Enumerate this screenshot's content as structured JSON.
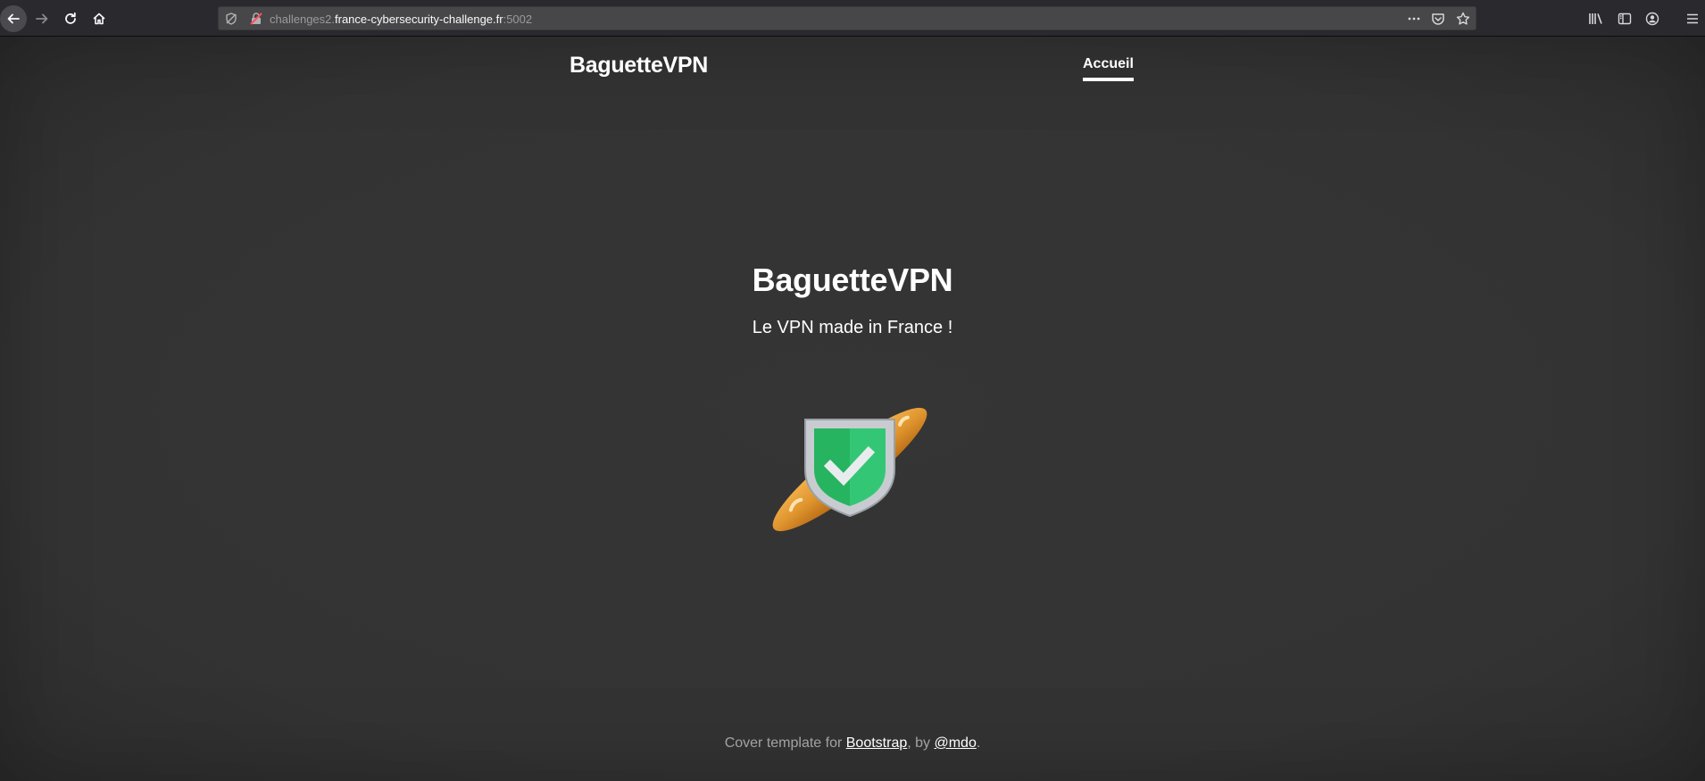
{
  "browser": {
    "url_prefix": "challenges2.",
    "url_host": "france-cybersecurity-challenge.fr",
    "url_suffix": ":5002",
    "icons": [
      "back-arrow-icon",
      "forward-arrow-icon",
      "reload-icon",
      "home-icon",
      "tracking-protection-icon",
      "insecure-lock-icon",
      "page-actions-icon",
      "pocket-icon",
      "bookmark-star-icon",
      "library-icon",
      "sidebar-icon",
      "account-icon",
      "hamburger-menu-icon"
    ]
  },
  "masthead": {
    "brand": "BaguetteVPN",
    "nav": [
      {
        "label": "Accueil",
        "active": true
      }
    ]
  },
  "hero": {
    "title": "BaguetteVPN",
    "subtitle": "Le VPN made in France !",
    "image": "baguette-shield-logo"
  },
  "footer": {
    "prefix": "Cover template for ",
    "link1": "Bootstrap",
    "middle": ", by ",
    "link2": "@mdo",
    "suffix": "."
  },
  "colors": {
    "background": "#333333",
    "text": "#ffffff",
    "shield_green": "#2ebd6b",
    "baguette": "#d98a2b"
  }
}
